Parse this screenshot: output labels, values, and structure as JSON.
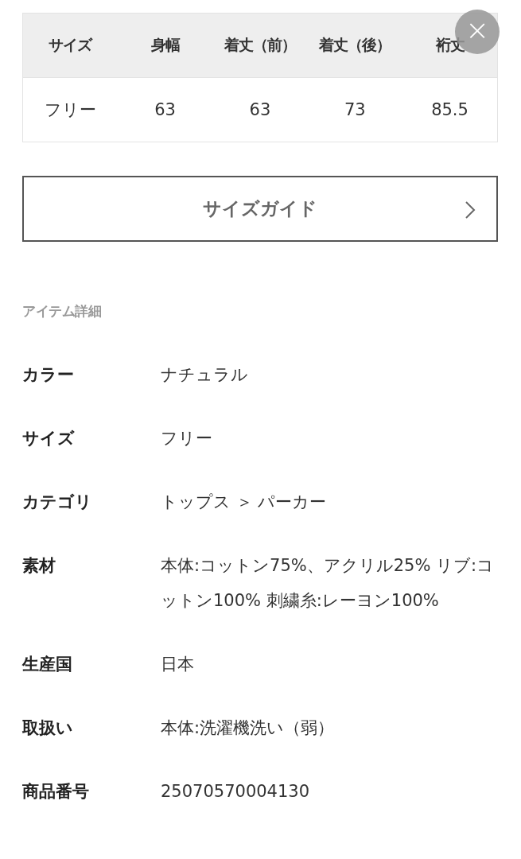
{
  "size_table": {
    "columns": [
      "サイズ",
      "身幅",
      "着丈（前）",
      "着丈（後）",
      "裄丈"
    ],
    "rows": [
      [
        "フリー",
        "63",
        "63",
        "73",
        "85.5"
      ]
    ]
  },
  "close_button": {
    "label": "×"
  },
  "size_guide_button": {
    "label": "サイズガイド"
  },
  "item_details": {
    "heading": "アイテム詳細",
    "rows": [
      {
        "label": "カラー",
        "value": "ナチュラル"
      },
      {
        "label": "サイズ",
        "value": "フリー"
      },
      {
        "label": "カテゴリ",
        "value": "トップス ＞ パーカー"
      },
      {
        "label": "素材",
        "value": "本体:コットン75%、アクリル25% リブ:コットン100% 刺繍糸:レーヨン100%"
      },
      {
        "label": "生産国",
        "value": "日本"
      },
      {
        "label": "取扱い",
        "value": "本体:洗濯機洗い（弱）"
      },
      {
        "label": "商品番号",
        "value": "25070570004130"
      }
    ]
  }
}
